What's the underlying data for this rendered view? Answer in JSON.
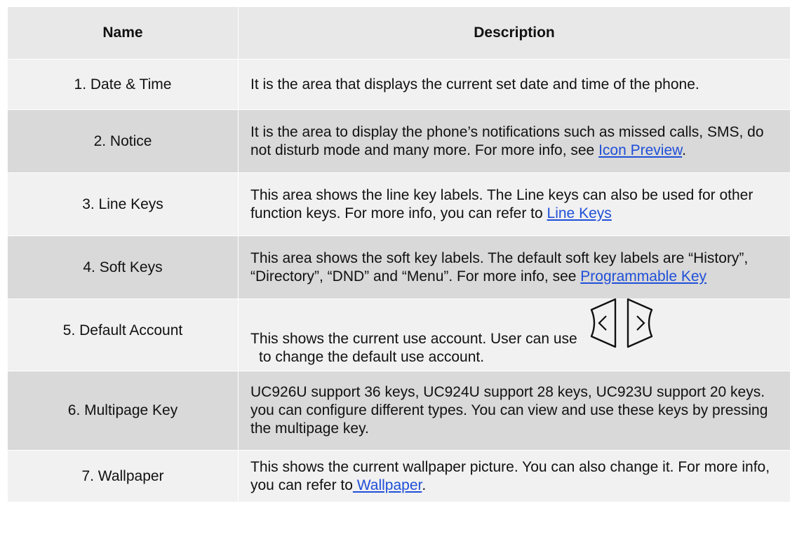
{
  "headers": {
    "name": "Name",
    "description": "Description"
  },
  "rows": [
    {
      "name": "1. Date & Time",
      "desc": "It is the area that displays the current set date and time of the phone."
    },
    {
      "name": "2. Notice",
      "desc": "It is the area to display the phone’s notifications such as missed calls, SMS, do not disturb mode and many more. For more info, see ",
      "link": "Icon Preview",
      "after": "."
    },
    {
      "name": "3. Line Keys",
      "desc": "This area shows the line key labels. The Line keys can also be used for other function keys. For more info, you can refer to ",
      "link": "Line Keys"
    },
    {
      "name": "4. Soft Keys",
      "desc": "This area shows the soft key labels. The default soft key labels are “History”, “Directory”, “DND” and “Menu”. For more info, see ",
      "link": "Programmable Key"
    },
    {
      "name": "5. Default Account",
      "desc": "This shows the current use account. User can use",
      "desc2": "to change the default use account."
    },
    {
      "name": "6. Multipage Key",
      "desc": "UC926U support 36 keys, UC924U support 28 keys, UC923U support 20 keys. you can configure different types. You can view and use these keys by pressing the multipage key."
    },
    {
      "name": "7. Wallpaper",
      "desc": "This shows the current wallpaper picture. You can also change it. For more info, you can refer to",
      "link": " Wallpaper",
      "after": "."
    }
  ],
  "icons": {
    "left": "chevron-left-key-icon",
    "right": "chevron-right-key-icon"
  },
  "colors": {
    "header_bg": "#e8e8e8",
    "row_light": "#f1f1f1",
    "row_dark": "#d9d9d9",
    "link": "#1f4fd8"
  }
}
